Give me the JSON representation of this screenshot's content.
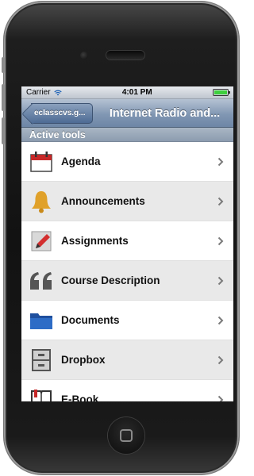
{
  "status_bar": {
    "carrier": "Carrier",
    "time": "4:01 PM",
    "battery_level": 1.0,
    "battery_color": "#3ecf3e"
  },
  "nav_bar": {
    "back_label": "eclasscvs.g...",
    "title": "Internet Radio and...",
    "bar_color": "#7890ae"
  },
  "section": {
    "header": "Active tools"
  },
  "tools": [
    {
      "label": "Agenda",
      "icon": "calendar-icon"
    },
    {
      "label": "Announcements",
      "icon": "bell-icon"
    },
    {
      "label": "Assignments",
      "icon": "pencil-paper-icon"
    },
    {
      "label": "Course Description",
      "icon": "quote-icon"
    },
    {
      "label": "Documents",
      "icon": "folder-icon"
    },
    {
      "label": "Dropbox",
      "icon": "cabinet-icon"
    },
    {
      "label": "E-Book",
      "icon": "book-icon"
    }
  ]
}
